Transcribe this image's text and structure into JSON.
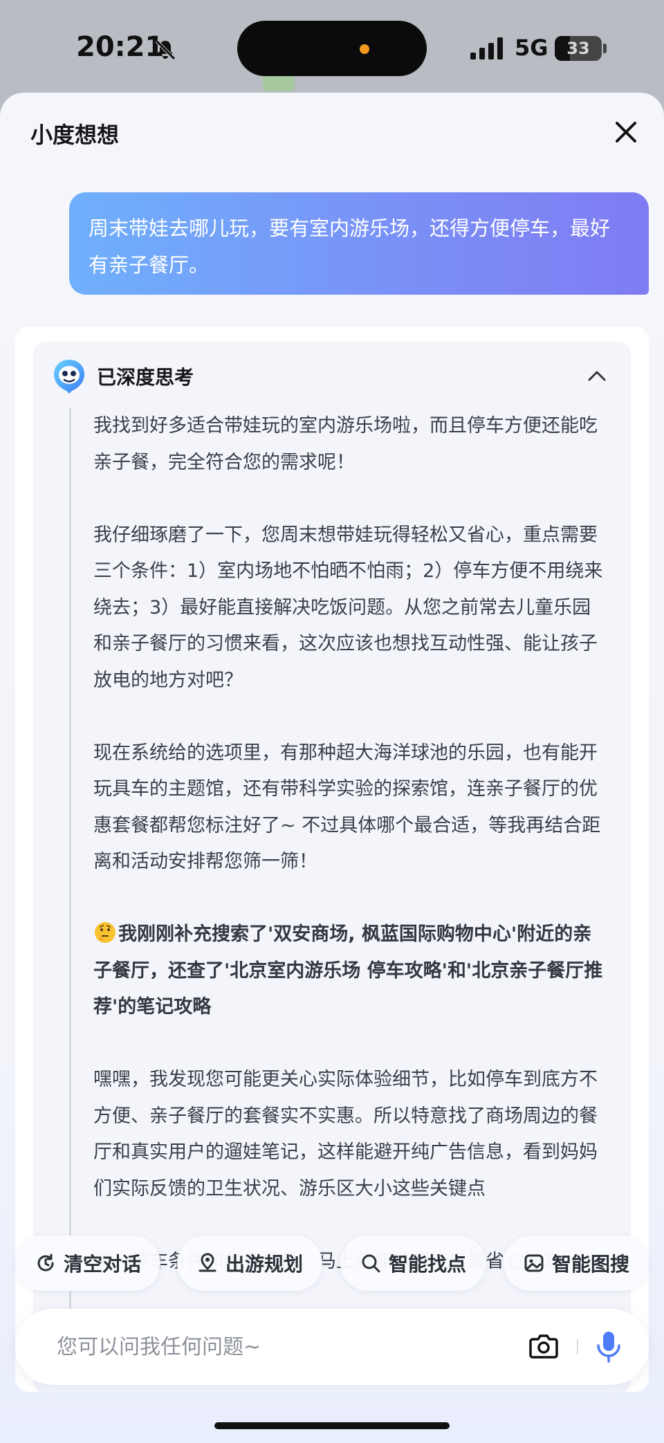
{
  "status_bar": {
    "time": "20:21",
    "network": "5G",
    "battery": "33",
    "battery_level": 0.33,
    "icons": [
      "bell-muted-icon",
      "signal-icon",
      "battery-icon"
    ]
  },
  "sheet": {
    "title": "小度想想"
  },
  "chat": {
    "user_message": "周末带娃去哪儿玩，要有室内游乐场，还得方便停车，最好有亲子餐厅。",
    "thinking": {
      "label": "已深度思考",
      "paragraphs": [
        "我找到好多适合带娃玩的室内游乐场啦，而且停车方便还能吃亲子餐，完全符合您的需求呢！",
        "我仔细琢磨了一下，您周末想带娃玩得轻松又省心，重点需要三个条件：1）室内场地不怕晒不怕雨；2）停车方便不用绕来绕去；3）最好能直接解决吃饭问题。从您之前常去儿童乐园和亲子餐厅的习惯来看，这次应该也想找互动性强、能让孩子放电的地方对吧？",
        "现在系统给的选项里，有那种超大海洋球池的乐园，也有能开玩具车的主题馆，还有带科学实验的探索馆，连亲子餐厅的优惠套餐都帮您标注好了~ 不过具体哪个最合适，等我再结合距离和活动安排帮您筛一筛！",
        "我刚刚补充搜索了'双安商场, 枫蓝国际购物中心'附近的亲子餐厅，还查了'北京室内游乐场 停车攻略'和'北京亲子餐厅推荐'的笔记攻略",
        "嘿嘿，我发现您可能更关心实际体验细节，比如停车到底方不方便、亲子餐厅的套餐实不实惠。所以特意找了商场周边的餐厅和真实用户的遛娃笔记，这样能避开纯广告信息，看到妈妈们实际反馈的卫生状况、游乐区大小这些关键点",
        "离、停车条件和餐食评价，马上就能给您挑出最省心的方"
      ]
    }
  },
  "quick_actions": [
    {
      "label": "清空对话",
      "icon": "clear-history-icon"
    },
    {
      "label": "出游规划",
      "icon": "travel-plan-icon"
    },
    {
      "label": "智能找点",
      "icon": "search-icon"
    },
    {
      "label": "智能图搜",
      "icon": "image-search-icon"
    }
  ],
  "input": {
    "placeholder": "您可以问我任何问题~",
    "icons": [
      "camera-icon",
      "microphone-icon"
    ]
  },
  "colors": {
    "bubble_gradient_start": "#6fb0fb",
    "bubble_gradient_end": "#7f7cf2",
    "mic_accent": "#4d7cf6",
    "status_dot": "#f39a1e"
  }
}
